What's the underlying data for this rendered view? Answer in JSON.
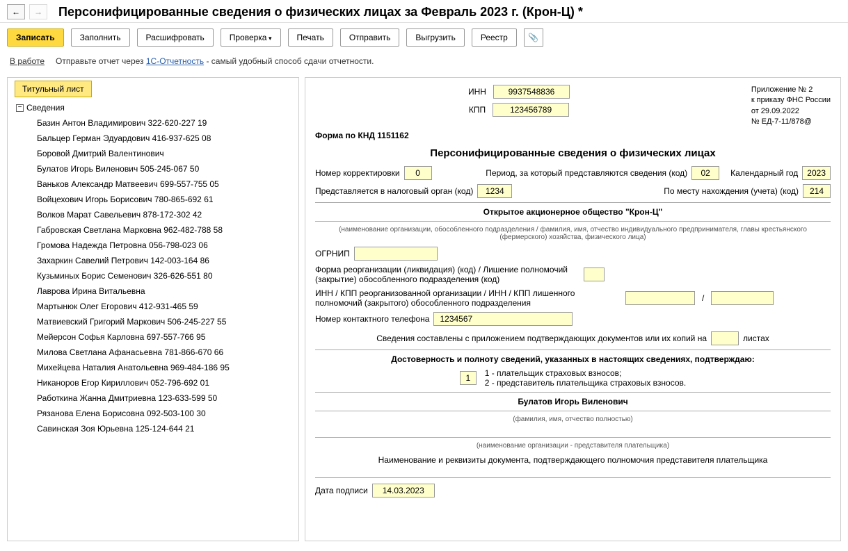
{
  "header": {
    "title": "Персонифицированные сведения о физических лицах за Февраль 2023 г. (Крон-Ц) *"
  },
  "toolbar": {
    "save": "Записать",
    "fill": "Заполнить",
    "decode": "Расшифровать",
    "check": "Проверка",
    "print": "Печать",
    "send": "Отправить",
    "export": "Выгрузить",
    "registry": "Реестр"
  },
  "status": {
    "label": "В работе",
    "hint_prefix": "Отправьте отчет через ",
    "hint_link": "1С-Отчетность",
    "hint_suffix": " - самый удобный способ сдачи отчетности."
  },
  "sidebar": {
    "tab": "Титульный лист",
    "parent": "Сведения",
    "items": [
      "Базин Антон Владимирович 322-620-227 19",
      "Бальцер Герман Эдуардович 416-937-625 08",
      "Боровой Дмитрий Валентинович",
      "Булатов Игорь Виленович 505-245-067 50",
      "Ваньков Александр Матвеевич 699-557-755 05",
      "Войцехович Игорь Борисович 780-865-692 61",
      "Волков Марат Савельевич 878-172-302 42",
      "Габровская Светлана Марковна 962-482-788 58",
      "Громова Надежда Петровна 056-798-023 06",
      "Захаркин Савелий Петрович 142-003-164 86",
      "Кузьминых Борис Семенович 326-626-551 80",
      "Лаврова Ирина Витальевна",
      "Мартынюк Олег Егорович 412-931-465 59",
      "Матвиевский Григорий Маркович 506-245-227 55",
      "Мейерсон Софья Карловна 697-557-766 95",
      "Милова Светлана Афанасьевна 781-866-670 66",
      "Михейцева Наталия Анатольевна 969-484-186 95",
      "Никаноров Егор Кириллович 052-796-692 01",
      "Работкина Жанна Дмитриевна 123-633-599 50",
      "Рязанова Елена Борисовна 092-503-100 30",
      "Савинская Зоя Юрьевна 125-124-644 21"
    ]
  },
  "doc": {
    "inn_lbl": "ИНН",
    "inn": "9937548836",
    "kpp_lbl": "КПП",
    "kpp": "123456789",
    "appendix_l1": "Приложение № 2",
    "appendix_l2": "к приказу ФНС России",
    "appendix_l3": "от 29.09.2022",
    "appendix_l4": "№ ЕД-7-11/878@",
    "form_code_lbl": "Форма по КНД 1151162",
    "title": "Персонифицированные сведения о физических лицах",
    "corr_lbl": "Номер корректировки",
    "corr": "0",
    "period_lbl": "Период, за который представляются сведения (код)",
    "period": "02",
    "year_lbl": "Календарный год",
    "year": "2023",
    "tax_lbl": "Представляется в налоговый орган (код)",
    "tax": "1234",
    "loc_lbl": "По месту нахождения (учета) (код)",
    "loc": "214",
    "org": "Открытое акционерное общество \"Крон-Ц\"",
    "org_hint": "(наименование организации, обособленного подразделения / фамилия, имя, отчество индивидуального предпринимателя, главы крестьянского (фермерского) хозяйства, физического лица)",
    "ogrnip_lbl": "ОГРНИП",
    "reorg_lbl": "Форма реорганизации (ликвидация) (код) / Лишение полномочий (закрытие) обособленного подразделения (код)",
    "reorg_inn_lbl": "ИНН / КПП реорганизованной организации / ИНН / КПП лишенного полномочий (закрытого) обособленного подразделения",
    "phone_lbl": "Номер контактного телефона",
    "phone": "1234567",
    "sheets_lbl_pre": "Сведения составлены с приложением подтверждающих документов или их копий на",
    "sheets_lbl_post": "листах",
    "confirm_title": "Достоверность и полноту сведений, указанных в настоящих сведениях, подтверждаю:",
    "confirm_code": "1",
    "confirm_opt1": "1 - плательщик страховых взносов;",
    "confirm_opt2": "2 - представитель плательщика страховых взносов.",
    "signer": "Булатов Игорь Виленович",
    "signer_hint": "(фамилия, имя, отчество полностью)",
    "rep_org_hint": "(наименование организации - представителя плательщика)",
    "rep_doc_lbl": "Наименование и реквизиты документа, подтверждающего полномочия представителя плательщика",
    "sign_date_lbl": "Дата подписи",
    "sign_date": "14.03.2023"
  }
}
